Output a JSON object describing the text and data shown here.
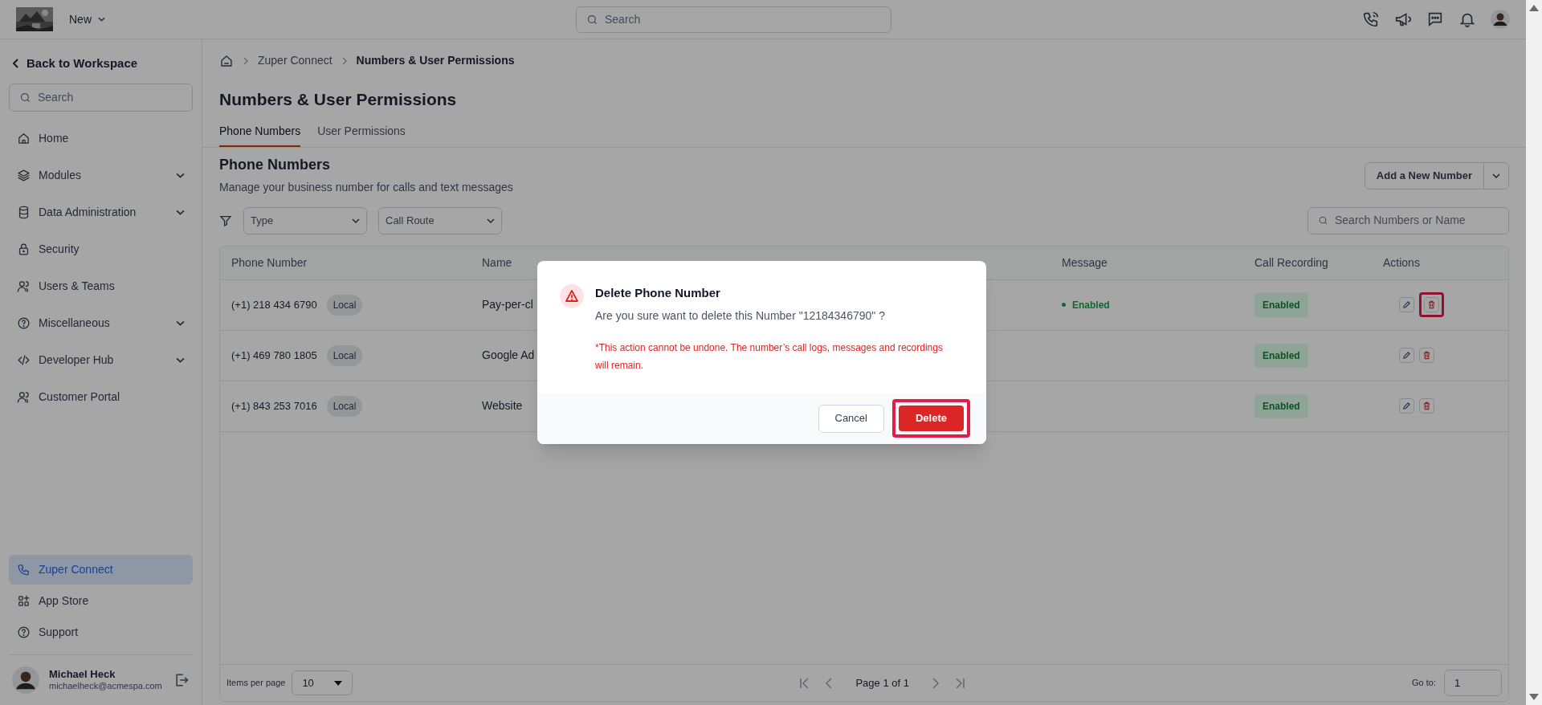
{
  "topbar": {
    "menu_label": "New",
    "search_placeholder": "Search"
  },
  "sidebar": {
    "back_link": "Back to Workspace",
    "search_placeholder": "Search",
    "items": [
      {
        "label": "Home",
        "expandable": false,
        "selected": false
      },
      {
        "label": "Modules",
        "expandable": true,
        "selected": false
      },
      {
        "label": "Data Administration",
        "expandable": true,
        "selected": false
      },
      {
        "label": "Security",
        "expandable": false,
        "selected": false
      },
      {
        "label": "Users & Teams",
        "expandable": false,
        "selected": false
      },
      {
        "label": "Miscellaneous",
        "expandable": true,
        "selected": false
      },
      {
        "label": "Developer Hub",
        "expandable": true,
        "selected": false
      },
      {
        "label": "Customer Portal",
        "expandable": false,
        "selected": false
      }
    ],
    "bottom_items": [
      {
        "label": "Zuper Connect",
        "selected": true
      },
      {
        "label": "App Store",
        "selected": false
      },
      {
        "label": "Support",
        "selected": false
      }
    ],
    "user": {
      "name": "Michael Heck",
      "email": "michaelheck@acmespa.com"
    }
  },
  "breadcrumb": [
    "Zuper Connect",
    "Numbers & User Permissions"
  ],
  "title": "Numbers & User Permissions",
  "tabs": [
    {
      "label": "Phone Numbers",
      "selected": true
    },
    {
      "label": "User Permissions",
      "selected": false
    }
  ],
  "section": {
    "title": "Phone Numbers",
    "subtitle": "Manage your business number for calls and text messages",
    "add_button": "Add a New Number"
  },
  "filters": [
    {
      "placeholder": "Type"
    },
    {
      "placeholder": "Call Route"
    }
  ],
  "search_placeholder": "Search Numbers or Name",
  "table": {
    "columns": [
      "Phone Number",
      "Name",
      "Message",
      "Call Recording",
      "Actions"
    ],
    "rows": [
      {
        "phone": "(+1) 218 434 6790",
        "type": "Local",
        "name": "Pay-per-cl",
        "message": "Enabled",
        "recording": "Enabled",
        "delete_highlighted": true
      },
      {
        "phone": "(+1) 469 780 1805",
        "type": "Local",
        "name": "Google Ad",
        "recording": "Enabled",
        "delete_highlighted": false
      },
      {
        "phone": "(+1) 843 253 7016",
        "type": "Local",
        "name": "Website",
        "recording": "Enabled",
        "delete_highlighted": false
      }
    ]
  },
  "pagination": {
    "items_per_page_label": "Items per page",
    "per_page": "10",
    "page_label": "Page 1 of 1",
    "goto_label": "Go to:",
    "goto_value": "1"
  },
  "dialog": {
    "title": "Delete Phone Number",
    "message": "Are you sure want to delete this Number \"12184346790\" ?",
    "warning": "*This action cannot be undone. The number’s call logs, messages and recordings will remain.",
    "cancel": "Cancel",
    "delete": "Delete",
    "delete_highlighted": true
  }
}
